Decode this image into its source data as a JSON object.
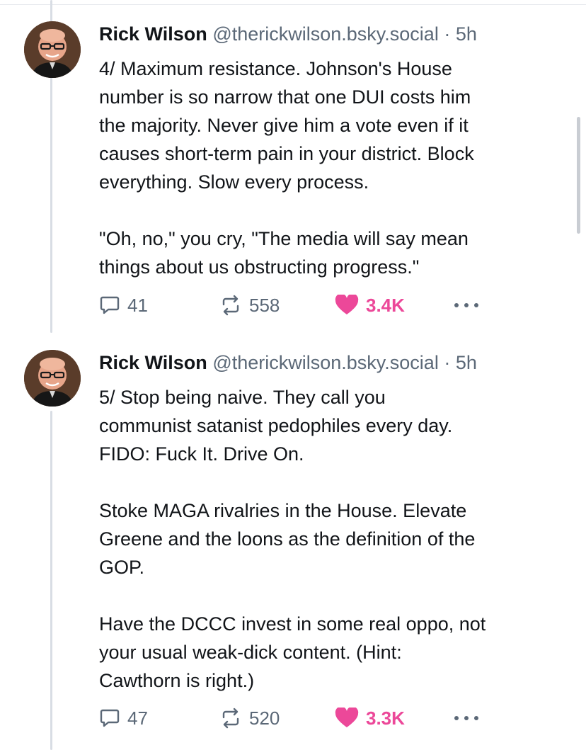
{
  "colors": {
    "like": "#ec4899",
    "muted": "#5b6877",
    "text": "#111418",
    "thread_line": "#d8dde4"
  },
  "posts": [
    {
      "author_name": "Rick Wilson",
      "handle": "@therickwilson.bsky.social",
      "separator": "·",
      "time": "5h",
      "text": "4/ Maximum resistance. Johnson's House\nnumber is so narrow that one DUI costs him\nthe majority. Never give him a vote even if it\ncauses short-term pain in your district. Block\neverything. Slow every process.\n\n\"Oh, no,\" you cry, \"The media will say mean\nthings about us obstructing progress.\"",
      "replies": "41",
      "reposts": "558",
      "likes": "3.4K",
      "icons": [
        "comment-icon",
        "repost-icon",
        "heart-icon",
        "more-icon"
      ]
    },
    {
      "author_name": "Rick Wilson",
      "handle": "@therickwilson.bsky.social",
      "separator": "·",
      "time": "5h",
      "text": "5/ Stop being naive. They call you\ncommunist satanist pedophiles every day.\nFIDO: Fuck It. Drive On.\n\nStoke MAGA rivalries in the House. Elevate\nGreene and the loons as the definition of the\nGOP.\n\nHave the DCCC invest in some real oppo, not\nyour usual weak-dick content. (Hint:\nCawthorn is right.)",
      "replies": "47",
      "reposts": "520",
      "likes": "3.3K",
      "icons": [
        "comment-icon",
        "repost-icon",
        "heart-icon",
        "more-icon"
      ]
    }
  ]
}
